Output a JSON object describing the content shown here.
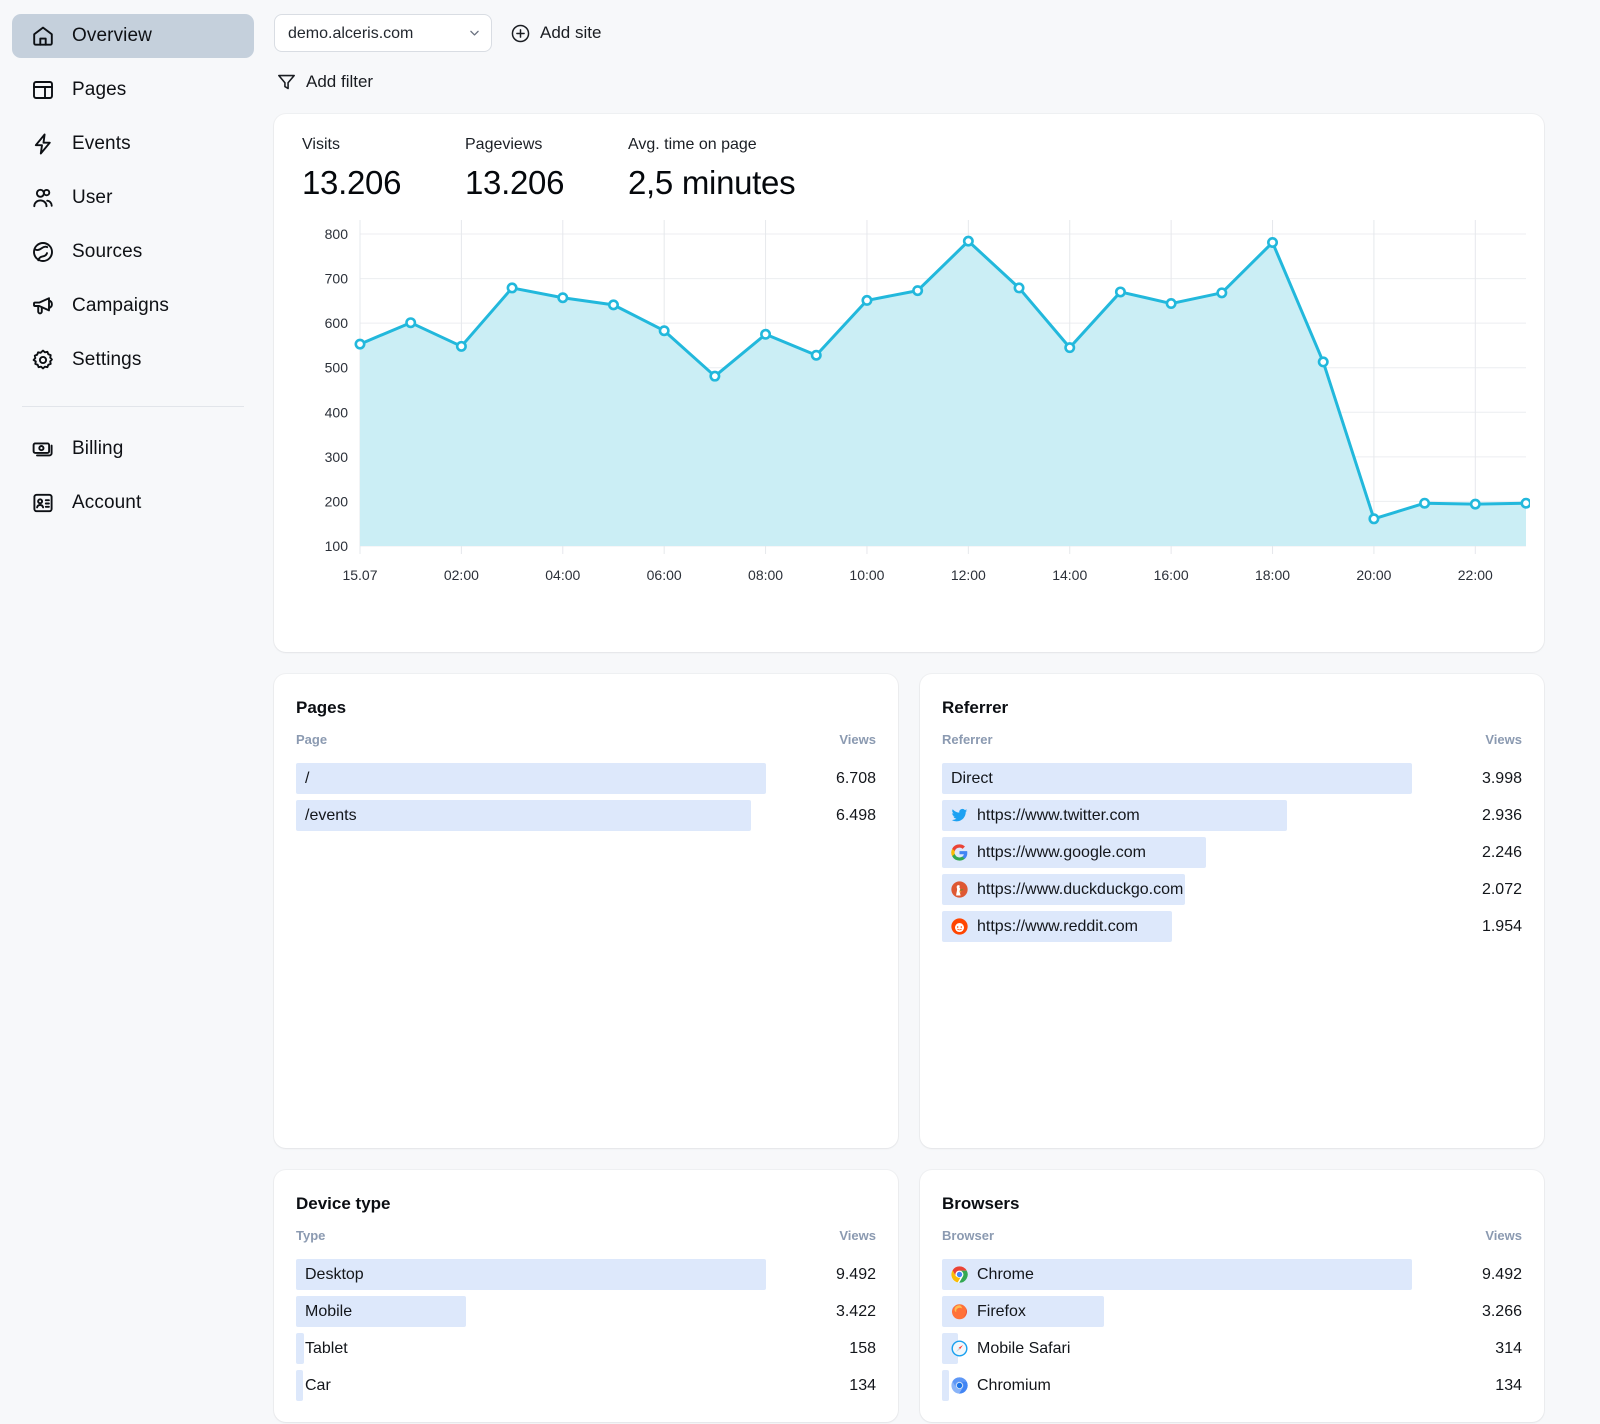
{
  "sidebar": {
    "items": [
      {
        "label": "Overview",
        "icon": "home-icon",
        "active": true
      },
      {
        "label": "Pages",
        "icon": "pages-icon",
        "active": false
      },
      {
        "label": "Events",
        "icon": "bolt-icon",
        "active": false
      },
      {
        "label": "User",
        "icon": "users-icon",
        "active": false
      },
      {
        "label": "Sources",
        "icon": "globe-icon",
        "active": false
      },
      {
        "label": "Campaigns",
        "icon": "megaphone-icon",
        "active": false
      },
      {
        "label": "Settings",
        "icon": "gear-icon",
        "active": false
      }
    ],
    "footer_items": [
      {
        "label": "Billing",
        "icon": "billing-icon"
      },
      {
        "label": "Account",
        "icon": "account-icon"
      }
    ]
  },
  "toolbar": {
    "site_selected": "demo.alceris.com",
    "site_options": [
      "demo.alceris.com"
    ],
    "add_site_label": "Add site",
    "add_filter_label": "Add filter"
  },
  "kpis": [
    {
      "label": "Visits",
      "value": "13.206"
    },
    {
      "label": "Pageviews",
      "value": "13.206"
    },
    {
      "label": "Avg. time on page",
      "value": "2,5 minutes"
    }
  ],
  "chart_data": {
    "type": "area",
    "title": "",
    "xlabel": "",
    "ylabel": "",
    "ylim": [
      100,
      800
    ],
    "yticks": [
      100,
      200,
      300,
      400,
      500,
      600,
      700,
      800
    ],
    "xticks": [
      "15.07",
      "02:00",
      "04:00",
      "06:00",
      "08:00",
      "10:00",
      "12:00",
      "14:00",
      "16:00",
      "18:00",
      "20:00",
      "22:00"
    ],
    "grid": true,
    "legend": "none",
    "line_color": "#22b8dc",
    "fill_color": "#cbeef5",
    "x": [
      "15.07",
      "01:00",
      "02:00",
      "03:00",
      "04:00",
      "05:00",
      "06:00",
      "07:00",
      "08:00",
      "09:00",
      "10:00",
      "11:00",
      "12:00",
      "13:00",
      "14:00",
      "15:00",
      "16:00",
      "17:00",
      "18:00",
      "19:00",
      "20:00",
      "21:00",
      "22:00",
      "23:00"
    ],
    "values": [
      553,
      601,
      548,
      679,
      657,
      641,
      583,
      481,
      575,
      528,
      651,
      673,
      784,
      679,
      545,
      670,
      644,
      668,
      781,
      513,
      161,
      196,
      194,
      196
    ]
  },
  "panels": {
    "pages": {
      "title": "Pages",
      "columns": [
        "Page",
        "Views"
      ],
      "rows": [
        {
          "label": "/",
          "value": "6.708",
          "pct": 100
        },
        {
          "label": "/events",
          "value": "6.498",
          "pct": 96.9
        }
      ]
    },
    "referrer": {
      "title": "Referrer",
      "columns": [
        "Referrer",
        "Views"
      ],
      "rows": [
        {
          "label": "Direct",
          "value": "3.998",
          "pct": 100,
          "icon": ""
        },
        {
          "label": "https://www.twitter.com",
          "value": "2.936",
          "pct": 73.4,
          "icon": "twitter-icon"
        },
        {
          "label": "https://www.google.com",
          "value": "2.246",
          "pct": 56.2,
          "icon": "google-icon"
        },
        {
          "label": "https://www.duckduckgo.com",
          "value": "2.072",
          "pct": 51.8,
          "icon": "duckduckgo-icon"
        },
        {
          "label": "https://www.reddit.com",
          "value": "1.954",
          "pct": 48.9,
          "icon": "reddit-icon"
        }
      ]
    },
    "device_type": {
      "title": "Device type",
      "columns": [
        "Type",
        "Views"
      ],
      "rows": [
        {
          "label": "Desktop",
          "value": "9.492",
          "pct": 100
        },
        {
          "label": "Mobile",
          "value": "3.422",
          "pct": 36.1
        },
        {
          "label": "Tablet",
          "value": "158",
          "pct": 1.7
        },
        {
          "label": "Car",
          "value": "134",
          "pct": 1.4
        }
      ]
    },
    "browsers": {
      "title": "Browsers",
      "columns": [
        "Browser",
        "Views"
      ],
      "rows": [
        {
          "label": "Chrome",
          "value": "9.492",
          "pct": 100,
          "icon": "chrome-icon"
        },
        {
          "label": "Firefox",
          "value": "3.266",
          "pct": 34.4,
          "icon": "firefox-icon"
        },
        {
          "label": "Mobile Safari",
          "value": "314",
          "pct": 3.3,
          "icon": "safari-icon"
        },
        {
          "label": "Chromium",
          "value": "134",
          "pct": 1.4,
          "icon": "chromium-icon"
        }
      ]
    }
  },
  "colors": {
    "accent": "#22b8dc",
    "chart_fill": "#cbeef5",
    "bar": "#dde8fb",
    "sidebar_active": "#c5d0dc",
    "page_bg": "#f7f8fa"
  }
}
